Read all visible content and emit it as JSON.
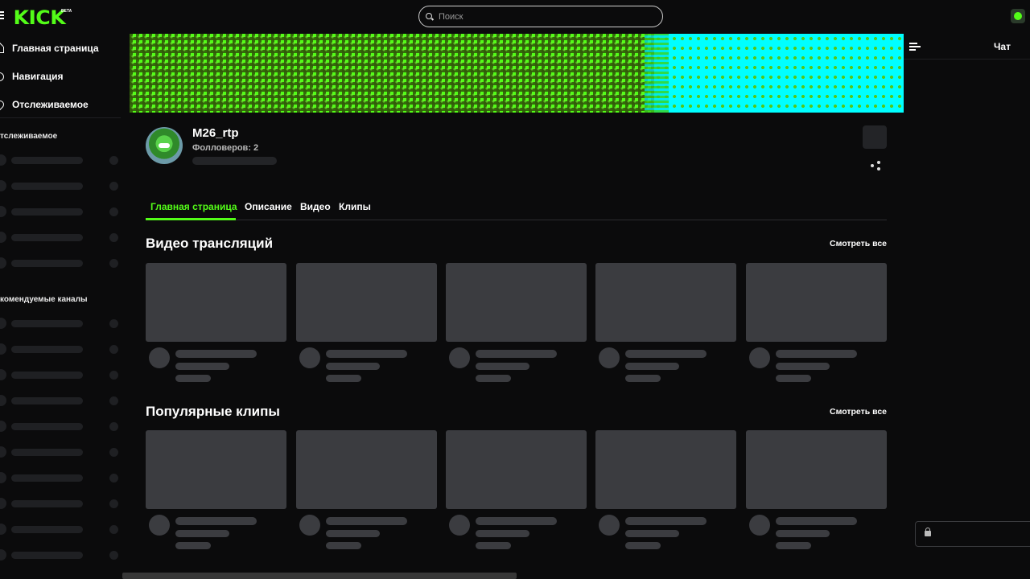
{
  "brand": {
    "logo": "KICK",
    "badge": "BETA",
    "accent_color": "#53fc18"
  },
  "search": {
    "placeholder": "Поиск",
    "value": ""
  },
  "sidebar": {
    "nav": [
      {
        "label": "Главная страница",
        "icon": "home-icon"
      },
      {
        "label": "Навигация",
        "icon": "compass-icon"
      },
      {
        "label": "Отслеживаемое",
        "icon": "heart-icon"
      }
    ],
    "following_title": "тслеживаемое",
    "recommended_title": "комендуемые каналы"
  },
  "channel": {
    "name": "M26_rtp",
    "followers_label": "Фолловеров: 2"
  },
  "tabs": [
    {
      "label": "Главная страница",
      "active": true
    },
    {
      "label": "Описание",
      "active": false
    },
    {
      "label": "Видео",
      "active": false
    },
    {
      "label": "Клипы",
      "active": false
    }
  ],
  "sections": {
    "videos": {
      "title": "Видео трансляций",
      "see_all": "Смотреть все"
    },
    "clips": {
      "title": "Популярные клипы",
      "see_all": "Смотреть все"
    }
  },
  "chat": {
    "title": "Чат"
  },
  "colors": {
    "background": "#0b0b0c",
    "skeleton": "#3b3c40",
    "banner_green": "#53fc18",
    "banner_cyan": "#00ffff"
  }
}
